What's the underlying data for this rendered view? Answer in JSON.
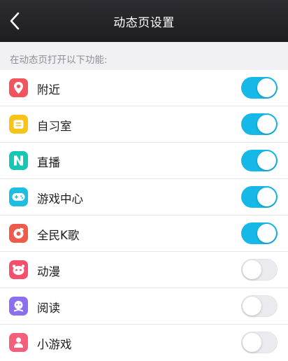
{
  "nav": {
    "title": "动态页设置",
    "back_icon": "chevron-left-icon"
  },
  "section": {
    "header": "在动态页打开以下功能:"
  },
  "items": [
    {
      "label": "附近",
      "icon": "location-pin-icon",
      "icon_color": "#f2555d",
      "enabled": true
    },
    {
      "label": "自习室",
      "icon": "study-room-icon",
      "icon_color": "#f7c418",
      "enabled": true
    },
    {
      "label": "直播",
      "icon": "live-stream-icon",
      "icon_color": "#18c7b3",
      "enabled": true
    },
    {
      "label": "游戏中心",
      "icon": "gamepad-icon",
      "icon_color": "#1cbfe3",
      "enabled": true
    },
    {
      "label": "全民K歌",
      "icon": "karaoke-icon",
      "icon_color": "#ef5a4a",
      "enabled": true
    },
    {
      "label": "动漫",
      "icon": "anime-icon",
      "icon_color": "#f4506e",
      "enabled": false
    },
    {
      "label": "阅读",
      "icon": "reading-icon",
      "icon_color": "#8c6ff0",
      "enabled": false
    },
    {
      "label": "小游戏",
      "icon": "mini-game-icon",
      "icon_color": "#f45f7a",
      "enabled": false
    }
  ],
  "colors": {
    "toggle_on": "#15b8e6",
    "toggle_off": "#ebebef",
    "nav_bg": "#27272b"
  }
}
